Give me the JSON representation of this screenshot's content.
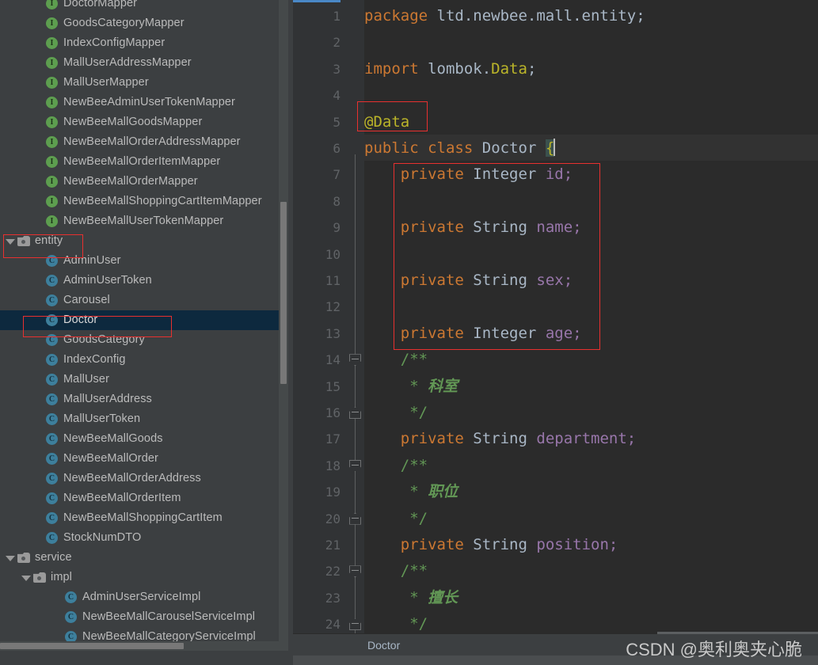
{
  "sidebar": {
    "scrollbar_vertical": "tree-vertical-scrollbar",
    "scrollbar_horizontal": "tree-horizontal-scrollbar",
    "items": [
      {
        "label": "DoctorMapper",
        "kind": "interface",
        "indent": 2
      },
      {
        "label": "GoodsCategoryMapper",
        "kind": "interface",
        "indent": 2
      },
      {
        "label": "IndexConfigMapper",
        "kind": "interface",
        "indent": 2
      },
      {
        "label": "MallUserAddressMapper",
        "kind": "interface",
        "indent": 2
      },
      {
        "label": "MallUserMapper",
        "kind": "interface",
        "indent": 2
      },
      {
        "label": "NewBeeAdminUserTokenMapper",
        "kind": "interface",
        "indent": 2
      },
      {
        "label": "NewBeeMallGoodsMapper",
        "kind": "interface",
        "indent": 2
      },
      {
        "label": "NewBeeMallOrderAddressMapper",
        "kind": "interface",
        "indent": 2
      },
      {
        "label": "NewBeeMallOrderItemMapper",
        "kind": "interface",
        "indent": 2
      },
      {
        "label": "NewBeeMallOrderMapper",
        "kind": "interface",
        "indent": 2
      },
      {
        "label": "NewBeeMallShoppingCartItemMapper",
        "kind": "interface",
        "indent": 2
      },
      {
        "label": "NewBeeMallUserTokenMapper",
        "kind": "interface",
        "indent": 2
      },
      {
        "label": "entity",
        "kind": "folder",
        "indent": 0,
        "expanded": true,
        "highlighted": true
      },
      {
        "label": "AdminUser",
        "kind": "class",
        "indent": 2
      },
      {
        "label": "AdminUserToken",
        "kind": "class",
        "indent": 2
      },
      {
        "label": "Carousel",
        "kind": "class",
        "indent": 2
      },
      {
        "label": "Doctor",
        "kind": "class",
        "indent": 2,
        "selected": true,
        "highlighted": true
      },
      {
        "label": "GoodsCategory",
        "kind": "class",
        "indent": 2
      },
      {
        "label": "IndexConfig",
        "kind": "class",
        "indent": 2
      },
      {
        "label": "MallUser",
        "kind": "class",
        "indent": 2
      },
      {
        "label": "MallUserAddress",
        "kind": "class",
        "indent": 2
      },
      {
        "label": "MallUserToken",
        "kind": "class",
        "indent": 2
      },
      {
        "label": "NewBeeMallGoods",
        "kind": "class",
        "indent": 2
      },
      {
        "label": "NewBeeMallOrder",
        "kind": "class",
        "indent": 2
      },
      {
        "label": "NewBeeMallOrderAddress",
        "kind": "class",
        "indent": 2
      },
      {
        "label": "NewBeeMallOrderItem",
        "kind": "class",
        "indent": 2
      },
      {
        "label": "NewBeeMallShoppingCartItem",
        "kind": "class",
        "indent": 2
      },
      {
        "label": "StockNumDTO",
        "kind": "class",
        "indent": 2
      },
      {
        "label": "service",
        "kind": "folder",
        "indent": 0,
        "expanded": true
      },
      {
        "label": "impl",
        "kind": "folder",
        "indent": 1,
        "expanded": true
      },
      {
        "label": "AdminUserServiceImpl",
        "kind": "class",
        "indent": 3
      },
      {
        "label": "NewBeeMallCarouselServiceImpl",
        "kind": "class",
        "indent": 3
      },
      {
        "label": "NewBeeMallCategoryServiceImpl",
        "kind": "class",
        "indent": 3
      }
    ]
  },
  "editor": {
    "line_numbers": [
      "1",
      "2",
      "3",
      "4",
      "5",
      "6",
      "7",
      "8",
      "9",
      "10",
      "11",
      "12",
      "13",
      "14",
      "15",
      "16",
      "17",
      "18",
      "19",
      "20",
      "21",
      "22",
      "23",
      "24"
    ],
    "lines": [
      {
        "n": "1",
        "text": "package ltd.newbee.mall.entity;"
      },
      {
        "n": "2",
        "text": ""
      },
      {
        "n": "3",
        "text": "import lombok.Data;"
      },
      {
        "n": "4",
        "text": ""
      },
      {
        "n": "5",
        "text": "@Data"
      },
      {
        "n": "6",
        "text": "public class Doctor {"
      },
      {
        "n": "7",
        "text": "    private Integer id;"
      },
      {
        "n": "8",
        "text": ""
      },
      {
        "n": "9",
        "text": "    private String name;"
      },
      {
        "n": "10",
        "text": ""
      },
      {
        "n": "11",
        "text": "    private String sex;"
      },
      {
        "n": "12",
        "text": ""
      },
      {
        "n": "13",
        "text": "    private Integer age;"
      },
      {
        "n": "14",
        "text": "    /**"
      },
      {
        "n": "15",
        "text": "     * 科室"
      },
      {
        "n": "16",
        "text": "     */"
      },
      {
        "n": "17",
        "text": "    private String department;"
      },
      {
        "n": "18",
        "text": "    /**"
      },
      {
        "n": "19",
        "text": "     * 职位"
      },
      {
        "n": "20",
        "text": "     */"
      },
      {
        "n": "21",
        "text": "    private String position;"
      },
      {
        "n": "22",
        "text": "    /**"
      },
      {
        "n": "23",
        "text": "     * 擅长"
      },
      {
        "n": "24",
        "text": "     */"
      }
    ],
    "tokens": {
      "kw_package": "package",
      "pkg_name": "ltd.newbee.mall.entity;",
      "kw_import": "import",
      "import_pkg": "lombok.",
      "import_cls": "Data",
      "semi": ";",
      "annotation": "@Data",
      "kw_public": "public",
      "kw_class": "class",
      "cls_name": "Doctor",
      "brace_open": "{",
      "kw_private": "private",
      "type_integer": "Integer",
      "type_string": "String",
      "f_id": "id;",
      "f_name": "name;",
      "f_sex": "sex;",
      "f_age": "age;",
      "f_department": "department;",
      "f_position": "position;",
      "cmt_open": "/**",
      "cmt_close": "*/",
      "cmt_star": "*",
      "cmt_keshi": "科室",
      "cmt_zhiwei": "职位",
      "cmt_shanchang": "擅长"
    }
  },
  "status": {
    "breadcrumb": "Doctor"
  },
  "watermark": {
    "text": "CSDN @奥利奥夹心脆"
  },
  "colors": {
    "editor_bg": "#2b2b2b",
    "gutter_bg": "#313335",
    "panel_bg": "#3c3f41",
    "selection_bg": "#0d293e",
    "accent_tab": "#4a88c7",
    "annotation_box": "#e8302f",
    "keyword": "#cc7832",
    "field": "#9876aa",
    "comment": "#629755",
    "annotation_text": "#bbb529",
    "default_text": "#a9b7c6",
    "interface_icon": "#5d9e4f",
    "class_icon": "#3d7f9c"
  }
}
